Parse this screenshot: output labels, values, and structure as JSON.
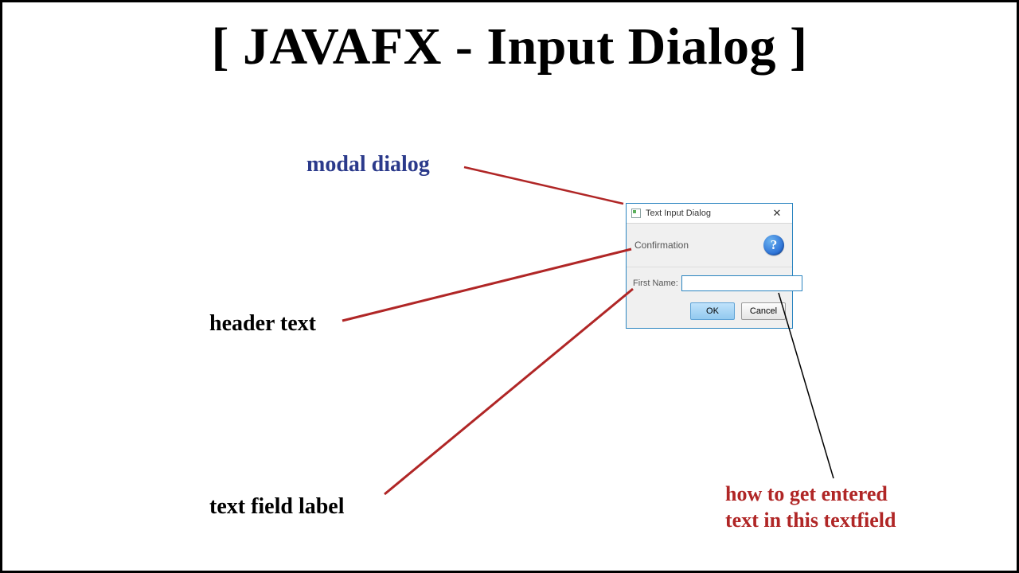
{
  "page_title": "[ JAVAFX - Input Dialog ]",
  "annotations": {
    "modal_dialog": "modal dialog",
    "header_text": "header text",
    "textfield_label": "text field label",
    "how_to_line1": "how to get entered",
    "how_to_line2": "text in this textfield"
  },
  "dialog": {
    "title": "Text Input Dialog",
    "close_glyph": "✕",
    "header": "Confirmation",
    "info_glyph": "?",
    "field_label": "First Name:",
    "input_value": "",
    "ok_label": "OK",
    "cancel_label": "Cancel"
  }
}
